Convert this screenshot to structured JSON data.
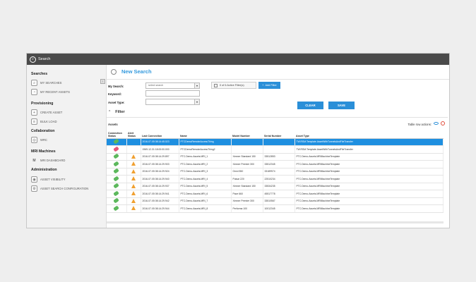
{
  "app": {
    "title": "Search"
  },
  "sidebar": {
    "sections": [
      {
        "title": "Searches",
        "items": [
          {
            "label": "MY SEARCHES",
            "icon": "searches-icon"
          },
          {
            "label": "MY RECENT ASSETS",
            "icon": "recent-assets-icon"
          }
        ]
      },
      {
        "title": "Provisioning",
        "items": [
          {
            "label": "CREATE ASSET",
            "icon": "create-asset-icon"
          },
          {
            "label": "BULK LOAD",
            "icon": "bulk-load-icon"
          }
        ]
      },
      {
        "title": "Collaboration",
        "items": [
          {
            "label": "WRC",
            "icon": "wrc-icon"
          }
        ]
      },
      {
        "title": "MRI Machines",
        "items": [
          {
            "label": "MRI DASHBOARD",
            "icon": "mri-dashboard-icon"
          }
        ]
      },
      {
        "title": "Administration",
        "items": [
          {
            "label": "ASSET VISIBILITY",
            "icon": "asset-visibility-icon"
          },
          {
            "label": "ASSET SEARCH CONFIGURATION",
            "icon": "search-config-icon"
          }
        ]
      }
    ]
  },
  "search": {
    "heading": "New Search",
    "my_search_label": "My Search:",
    "my_search_value": "select search",
    "keyword_label": "Keyword:",
    "asset_type_label": "Asset Type:",
    "filter_count": "0 of 6 Active Filter(s)",
    "add_filter": "Add Filter",
    "clear": "CLEAR",
    "save": "SAVE",
    "filter_header": "Filter"
  },
  "assets": {
    "label": "Assets",
    "table_row_actions": "Table row actions:",
    "columns": [
      "Connection Status",
      "Alert Status",
      "Last Connection",
      "Name",
      "Model Number",
      "Serial Number",
      "Asset Type"
    ],
    "rows": [
      {
        "conn": "on",
        "alert": "",
        "last": "2016-07-05 08:14:45.023",
        "name": "PTCDemoRemoteAccessThing",
        "model": "",
        "serial": "",
        "type": "TW.RSM.Template.AssetWithTunnelsAndFileTransfer",
        "selected": true
      },
      {
        "conn": "off",
        "alert": "",
        "last": "1969-12-31 18:00:00.000",
        "name": "PTCDemoRemoteAccessThing2",
        "model": "",
        "serial": "",
        "type": "TW.RSM.Template.AssetWithTunnelsAndFileTransfer",
        "selected": false
      },
      {
        "conn": "on",
        "alert": "warn",
        "last": "2016-07-05 08:14:29.897",
        "name": "PTC.Demo.Assets.MRI_1",
        "model": "Xenner Standard 150",
        "serial": "33512853",
        "type": "PTC.Demo.Assets.MRIMachineTemplate",
        "selected": false
      },
      {
        "conn": "on",
        "alert": "warn",
        "last": "2016-07-05 08:14:29.903",
        "name": "PTC.Demo.Assets.MRI_2",
        "model": "Xenner Premier 300",
        "serial": "33512345",
        "type": "PTC.Demo.Assets.MRIMachineTemplate",
        "selected": false
      },
      {
        "conn": "on",
        "alert": "warn",
        "last": "2016-07-05 08:14:29.924",
        "name": "PTC.Demo.Assets.MRI_3",
        "model": "Omni 550",
        "serial": "33189974",
        "type": "PTC.Demo.Assets.MRIMachineTemplate",
        "selected": false
      },
      {
        "conn": "on",
        "alert": "warn",
        "last": "2016-07-05 08:14:29.940",
        "name": "PTC.Demo.Assets.MRI_4",
        "model": "Pulsar 220",
        "serial": "22510234",
        "type": "PTC.Demo.Assets.MRIMachineTemplate",
        "selected": false
      },
      {
        "conn": "on",
        "alert": "warn",
        "last": "2016-07-05 08:14:29.937",
        "name": "PTC.Demo.Assets.MRI_5",
        "model": "Xenner Standard 150",
        "serial": "33534235",
        "type": "PTC.Demo.Assets.MRIMachineTemplate",
        "selected": false
      },
      {
        "conn": "on",
        "alert": "warn",
        "last": "2016-07-05 08:14:29.941",
        "name": "PTC.Demo.Assets.MRI_6",
        "model": "Pace 660",
        "serial": "45517778",
        "type": "PTC.Demo.Assets.MRIMachineTemplate",
        "selected": false
      },
      {
        "conn": "on",
        "alert": "warn",
        "last": "2016-07-05 08:14:29.942",
        "name": "PTC.Demo.Assets.MRI_7",
        "model": "Xenner Premier 300",
        "serial": "33510567",
        "type": "PTC.Demo.Assets.MRIMachineTemplate",
        "selected": false
      },
      {
        "conn": "on",
        "alert": "warn",
        "last": "2016-07-05 08:14:29.944",
        "name": "PTC.Demo.Assets.MRI_8",
        "model": "Performa 100",
        "serial": "10012345",
        "type": "PTC.Demo.Assets.MRIMachineTemplate",
        "selected": false
      }
    ]
  },
  "colors": {
    "accent": "#2a8fd8",
    "titlebar": "#4a4a4a",
    "heading": "#3399dd",
    "connected": "#5cb85c",
    "disconnected": "#e7577a",
    "warning": "#f0a030"
  }
}
